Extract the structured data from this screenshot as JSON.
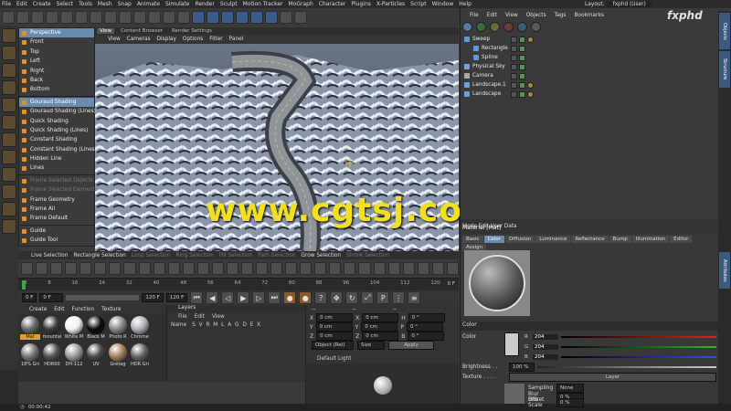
{
  "menubar": [
    "File",
    "Edit",
    "Create",
    "Select",
    "Tools",
    "Mesh",
    "Snap",
    "Animate",
    "Simulate",
    "Render",
    "Sculpt",
    "Motion Tracker",
    "MoGraph",
    "Character",
    "Plugins",
    "X-Particles",
    "Script",
    "Window",
    "Help"
  ],
  "layout": {
    "label": "Layout:",
    "value": "fxphd (User)"
  },
  "brand": "fxphd",
  "toolbar_icons": [
    "undo-icon",
    "redo-icon",
    "select-icon",
    "move-icon",
    "scale-icon",
    "rotate-icon",
    "axis-x-icon",
    "axis-y-icon",
    "axis-z-icon",
    "world-icon",
    "render-icon",
    "render-view-icon",
    "render-settings-icon",
    "cube-icon",
    "pen-icon",
    "subdivide-icon",
    "cloner-icon",
    "deformer-icon",
    "scene-icon",
    "camera-icon",
    "light-icon"
  ],
  "viewport_tabs": [
    {
      "label": "View",
      "active": true
    },
    {
      "label": "Content Browser",
      "active": false
    },
    {
      "label": "Render Settings",
      "active": false
    }
  ],
  "viewport_menu": [
    "View",
    "Cameras",
    "Display",
    "Options",
    "Filter",
    "Panel"
  ],
  "view_menu": [
    {
      "label": "Perspective",
      "type": "sel"
    },
    {
      "label": "Front",
      "type": "item"
    },
    {
      "label": "Top",
      "type": "item"
    },
    {
      "label": "Left",
      "type": "item"
    },
    {
      "label": "Right",
      "type": "item"
    },
    {
      "label": "Back",
      "type": "item"
    },
    {
      "label": "Bottom",
      "type": "item"
    },
    {
      "type": "sep"
    },
    {
      "label": "Gouraud Shading",
      "type": "sel"
    },
    {
      "label": "Gouraud Shading (Lines)",
      "type": "item"
    },
    {
      "label": "Quick Shading",
      "type": "item"
    },
    {
      "label": "Quick Shading (Lines)",
      "type": "item"
    },
    {
      "label": "Constant Shading",
      "type": "item"
    },
    {
      "label": "Constant Shading (Lines)",
      "type": "item"
    },
    {
      "label": "Hidden Line",
      "type": "item"
    },
    {
      "label": "Lines",
      "type": "item"
    },
    {
      "type": "sep"
    },
    {
      "label": "Frame Selected Objects",
      "type": "dim"
    },
    {
      "label": "Frame Selected Elements",
      "type": "dim"
    },
    {
      "label": "Frame Geometry",
      "type": "item"
    },
    {
      "label": "Frame All",
      "type": "item"
    },
    {
      "label": "Frame Default",
      "type": "item"
    },
    {
      "type": "sep"
    },
    {
      "label": "Guide",
      "type": "item"
    },
    {
      "label": "Guide Tool",
      "type": "item"
    }
  ],
  "watermark": "www.cgtsj.com",
  "selection_bar": [
    {
      "label": "Live Selection",
      "dim": false
    },
    {
      "label": "Rectangle Selection",
      "dim": false
    },
    {
      "label": "Loop Selection",
      "dim": true
    },
    {
      "label": "Ring Selection",
      "dim": true
    },
    {
      "label": "Fill Selection",
      "dim": true
    },
    {
      "label": "Path Selection",
      "dim": true
    },
    {
      "label": "Grow Selection",
      "dim": false
    },
    {
      "label": "Shrink Selection",
      "dim": true
    }
  ],
  "timeline": {
    "ticks": [
      "0",
      "8",
      "16",
      "24",
      "32",
      "40",
      "48",
      "56",
      "64",
      "72",
      "80",
      "88",
      "96",
      "104",
      "112",
      "120"
    ],
    "end": "0 F"
  },
  "transport": {
    "start": "0 F",
    "field2": "0 F",
    "end1": "120 F",
    "end2": "120 F"
  },
  "material_menu": [
    "Create",
    "Edit",
    "Function",
    "Texture"
  ],
  "materials": [
    {
      "name": "Mat",
      "color": "#6b6b6b",
      "selected": true
    },
    {
      "name": "mountai",
      "color": "#3a3a3a",
      "selected": false
    },
    {
      "name": "White M",
      "color": "#f2f2f2",
      "selected": false
    },
    {
      "name": "Black M",
      "color": "#0b0b0b",
      "selected": false
    },
    {
      "name": "Photo R",
      "color": "#888888",
      "selected": false
    },
    {
      "name": "Chrome",
      "color": "#b0b4b8",
      "selected": false
    },
    {
      "name": "18% Gri",
      "color": "#777777",
      "selected": false
    },
    {
      "name": "HDR00",
      "color": "#505050",
      "selected": false
    },
    {
      "name": "DH-112",
      "color": "#9a9a9a",
      "selected": false
    },
    {
      "name": "UV",
      "color": "#4a4a4a",
      "selected": false
    },
    {
      "name": "Gretag",
      "color": "#a08060",
      "selected": false
    },
    {
      "name": "HDR Gri",
      "color": "#666666",
      "selected": false
    }
  ],
  "layers": {
    "title": "Layers",
    "menu": [
      "File",
      "Edit",
      "View"
    ],
    "name_label": "Name",
    "columns": "S V R M L A G D E X"
  },
  "coords": {
    "dashes": "--",
    "rows": [
      [
        "X",
        "0 cm",
        "X",
        "0 cm",
        "H",
        "0 °"
      ],
      [
        "Y",
        "0 cm",
        "Y",
        "0 cm",
        "P",
        "0 °"
      ],
      [
        "Z",
        "0 cm",
        "Z",
        "0 cm",
        "B",
        "0 °"
      ]
    ],
    "mode": "Object (Rel)",
    "size": "Size",
    "apply": "Apply"
  },
  "light": {
    "title": "Default Light"
  },
  "object_menu": [
    "File",
    "Edit",
    "View",
    "Objects",
    "Tags",
    "Bookmarks"
  ],
  "objects": [
    {
      "name": "Sweep",
      "indent": 0,
      "color": "#5a9ad8"
    },
    {
      "name": "Rectangle",
      "indent": 1,
      "color": "#5a9ad8"
    },
    {
      "name": "Spline",
      "indent": 1,
      "color": "#5a9ad8"
    },
    {
      "name": "Physical Sky",
      "indent": 0,
      "color": "#7aa0d8"
    },
    {
      "name": "Camera",
      "indent": 0,
      "color": "#aaaaaa"
    },
    {
      "name": "Landscape.1",
      "indent": 0,
      "color": "#6aa0e0"
    },
    {
      "name": "Landscape",
      "indent": 0,
      "color": "#6aa0e0"
    }
  ],
  "side_tabs": [
    "Objects",
    "Structure",
    "Attributes"
  ],
  "attributes": {
    "mode_label": "Mode Edit User Data",
    "title": "Material [Mat]",
    "tabs": [
      {
        "label": "Basic",
        "active": false
      },
      {
        "label": "Color",
        "active": true
      },
      {
        "label": "Diffusion",
        "active": false
      },
      {
        "label": "Luminance",
        "active": false
      },
      {
        "label": "Reflectance",
        "active": false
      },
      {
        "label": "Bump",
        "active": false
      },
      {
        "label": "Illumination",
        "active": false
      },
      {
        "label": "Editor",
        "active": false
      },
      {
        "label": "Assign",
        "active": false
      }
    ],
    "section": "Color",
    "color_label": "Color",
    "r": "204",
    "g": "204",
    "b": "204",
    "brightness_label": "Brightness . .",
    "brightness": "100 %",
    "texture_label": "Texture . . . .",
    "texture_value": "Layer",
    "sampling_label": "Sampling",
    "sampling": "None",
    "blur_offset_label": "Blur Offset",
    "blur_offset": "0 %",
    "blur_scale_label": "Blur Scale",
    "blur_scale": "0 %"
  },
  "status": {
    "time": "00:00:42"
  }
}
